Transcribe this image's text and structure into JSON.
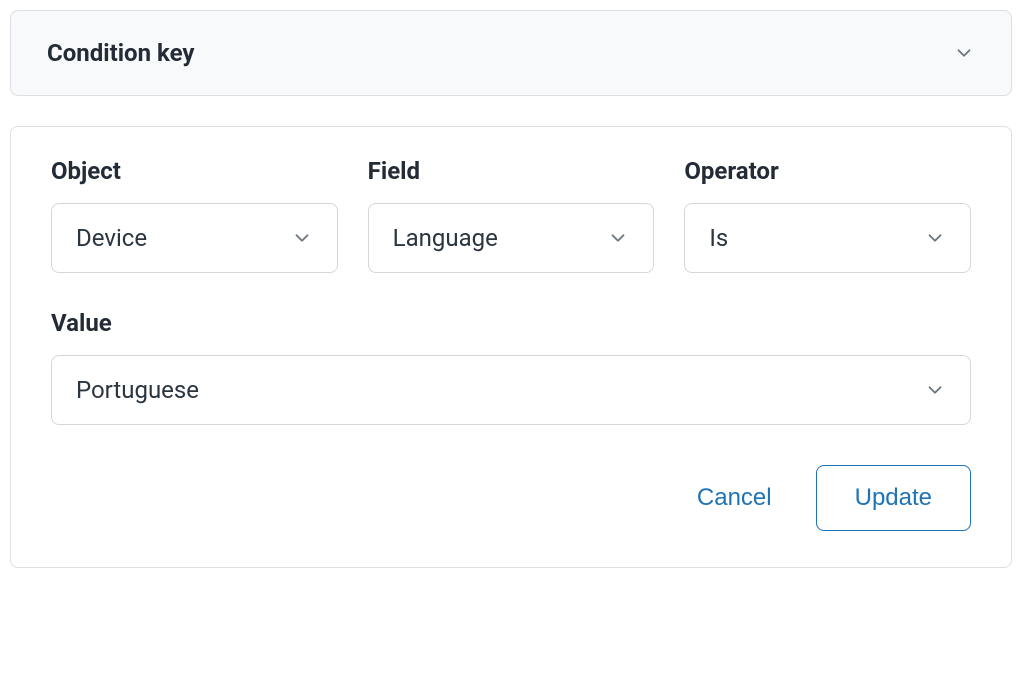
{
  "accordion": {
    "title": "Condition key"
  },
  "form": {
    "object": {
      "label": "Object",
      "value": "Device"
    },
    "field": {
      "label": "Field",
      "value": "Language"
    },
    "operator": {
      "label": "Operator",
      "value": "Is"
    },
    "value": {
      "label": "Value",
      "value": "Portuguese"
    }
  },
  "actions": {
    "cancel": "Cancel",
    "update": "Update"
  }
}
